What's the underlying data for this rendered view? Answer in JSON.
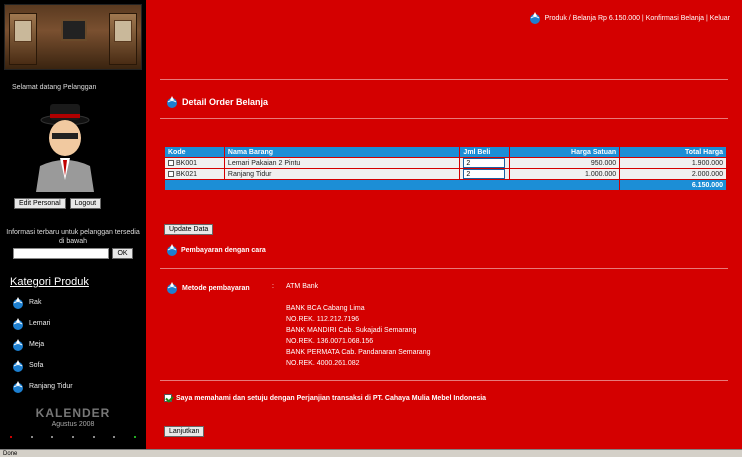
{
  "sidebar": {
    "welcome": "Selamat datang Pelanggan",
    "buttons": {
      "edit_profile": "Edit Personal",
      "logout": "Logout"
    },
    "info_text": "Informasi terbaru untuk pelanggan tersedia di bawah",
    "search_button": "OK",
    "categories_title": "Kategori Produk",
    "categories": [
      {
        "label": "Rak"
      },
      {
        "label": "Lemari"
      },
      {
        "label": "Meja"
      },
      {
        "label": "Sofa"
      },
      {
        "label": "Ranjang Tidur"
      }
    ],
    "calendar_title": "KALENDER",
    "calendar_sub": "Agustus 2008"
  },
  "main": {
    "breadcrumb": "Produk / Belanja Rp 6.150.000 | Konfirmasi Belanja | Keluar",
    "section_title": "Detail Order Belanja",
    "table": {
      "headers": [
        "Kode",
        "Nama Barang",
        "Jml Beli",
        "Harga Satuan",
        "Total Harga"
      ],
      "rows": [
        {
          "code": "BK001",
          "name": "Lemari Pakaian 2 Pintu",
          "qty": "2",
          "unit_price": "950.000",
          "total": "1.900.000"
        },
        {
          "code": "BK021",
          "name": "Ranjang Tidur",
          "qty": "2",
          "unit_price": "1.000.000",
          "total": "2.000.000"
        }
      ],
      "grand_total": "6.150.000"
    },
    "update_button": "Update Data",
    "pay_with": "Pembayaran dengan cara",
    "pay_method_label": "Metode pembayaran",
    "pay_separator": ":",
    "pay_method_value": "ATM Bank",
    "banks": [
      "BANK BCA Cabang Lima",
      "NO.REK. 112.212.7196",
      "BANK MANDIRI Cab. Sukajadi Semarang",
      "NO.REK. 136.0071.068.156",
      "BANK PERMATA Cab. Pandanaran Semarang",
      "NO.REK. 4000.261.082"
    ],
    "agree_text": "Saya memahami dan setuju dengan Perjanjian transaksi di PT. Cahaya Mulia Mebel Indonesia",
    "submit_button": "Lanjutkan"
  },
  "status_bar": {
    "text": "Done"
  },
  "colors": {
    "main_bg": "#d40000",
    "table_header": "#1c8ed6",
    "sidebar_bg": "#000000"
  },
  "icons": [
    "globe-icon",
    "user-avatar-icon",
    "checkbox-icon"
  ]
}
